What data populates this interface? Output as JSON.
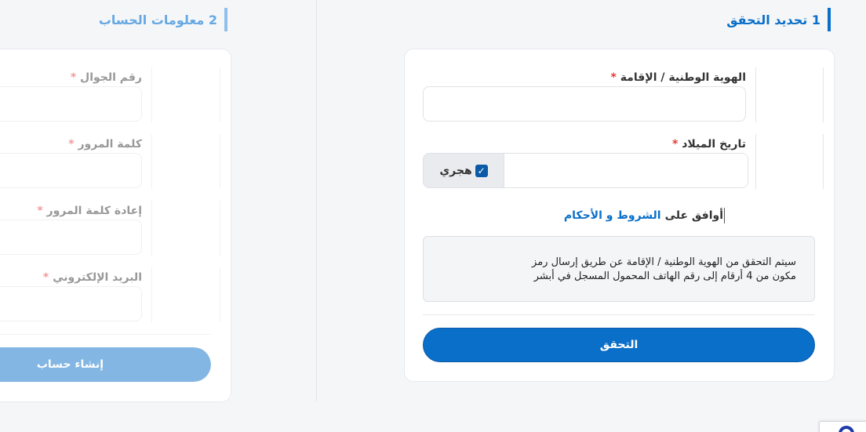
{
  "step1": {
    "number": "1",
    "title": "تحديد التحقق",
    "id_label": "الهوية الوطنية / الإقامة",
    "id_value": "",
    "dob_label": "تاريخ الميلاد",
    "dob_value": "",
    "hijri_label": "هجري",
    "hijri_checked": true,
    "agree_prefix": "أوافق على",
    "terms_link": "الشروط و الأحكام",
    "info_line1": "سيتم التحقق من الهوية الوطنية / الإقامة عن طريق إرسال رمز",
    "info_line2": "مكون من 4 أرقام إلى رقم الهاتف المحمول المسجل في أبشر",
    "verify_button": "التحقق",
    "required_mark": "*"
  },
  "step2": {
    "number": "2",
    "title": "معلومات الحساب",
    "mobile_label": "رقم الجوال",
    "password_label": "كلمة المرور",
    "confirm_password_label": "إعادة كلمة المرور",
    "email_label": "البريد الإلكتروني",
    "create_button": "إنشاء حساب",
    "required_mark": "*"
  },
  "colors": {
    "primary": "#0a6fc8",
    "primary_dark": "#0b5aa8",
    "required": "#e53935",
    "disabled_button": "#a9c9ea"
  }
}
